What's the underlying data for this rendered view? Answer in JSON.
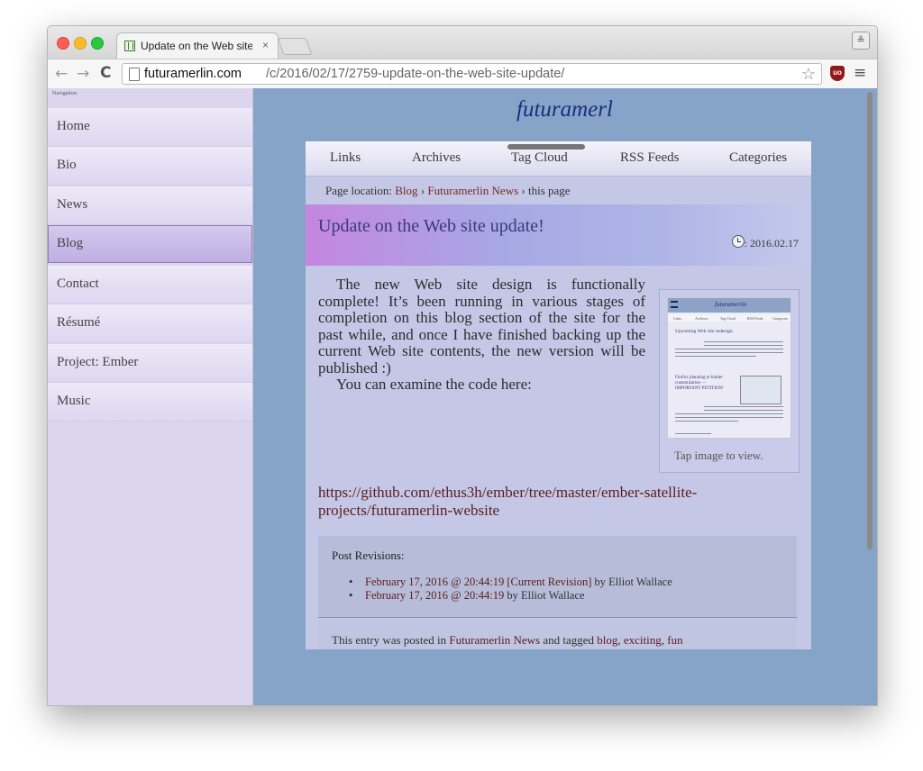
{
  "browser": {
    "tab_title": "Update on the Web site update!",
    "tab_close": "×",
    "url_host": "futuramerlin.com",
    "url_path": "/c/2016/02/17/2759-update-on-the-web-site-update/",
    "back_glyph": "←",
    "forward_glyph": "→",
    "reload_glyph": "C",
    "star_glyph": "☆",
    "menu_glyph": "≡",
    "ublock_label": "uo",
    "profile_glyph": "≗"
  },
  "sidebar": {
    "caption": "Navigation:",
    "items": [
      {
        "label": "Home"
      },
      {
        "label": "Bio"
      },
      {
        "label": "News"
      },
      {
        "label": "Blog"
      },
      {
        "label": "Contact"
      },
      {
        "label": "Résumé"
      },
      {
        "label": "Project: Ember"
      },
      {
        "label": "Music"
      }
    ],
    "active_item": "Blog"
  },
  "site": {
    "title": "futuramerl"
  },
  "menubar": {
    "items": [
      {
        "label": "Links"
      },
      {
        "label": "Archives"
      },
      {
        "label": "Tag Cloud"
      },
      {
        "label": "RSS Feeds"
      },
      {
        "label": "Categories"
      }
    ]
  },
  "breadcrumb": {
    "prefix": "Page location:",
    "blog": "Blog",
    "sep1": "›",
    "news": "Futuramerlin News",
    "sep2": "›",
    "current": "this page"
  },
  "post": {
    "title": "Update on the Web site update!",
    "date": ": 2016.02.17",
    "paragraph1": "The new Web site design is functionally complete! It’s been running in various stages of completion on this blog section of the site for the past while, and once I have finished backing up the current Web site contents, the new version will be published :)",
    "paragraph2": "You can examine the code here:",
    "link": "https://github.com/ethus3h/ember/tree/master/ember-satellite-projects/futuramerlin-website",
    "thumb_caption": "Tap image to view."
  },
  "revisions": {
    "title": "Post Revisions:",
    "items": [
      {
        "link": "February 17, 2016 @ 20:44:19 [Current Revision]",
        "by": "by Elliot Wallace"
      },
      {
        "link": "February 17, 2016 @ 20:44:19",
        "by": "by Elliot Wallace"
      }
    ]
  },
  "footer": {
    "prefix": "This entry was posted in",
    "category": "Futuramerlin News",
    "tagged": "and tagged",
    "tag1": "blog",
    "comma1": ",",
    "tag2": "exciting",
    "comma2": ",",
    "tag3": "fun"
  },
  "colors": {
    "page_background": "#86a4c8",
    "sidebar_background": "#dcd5ee",
    "content_background": "#c4c7e5",
    "link": "#5a1e1e",
    "site_title": "#1f2b7e"
  }
}
